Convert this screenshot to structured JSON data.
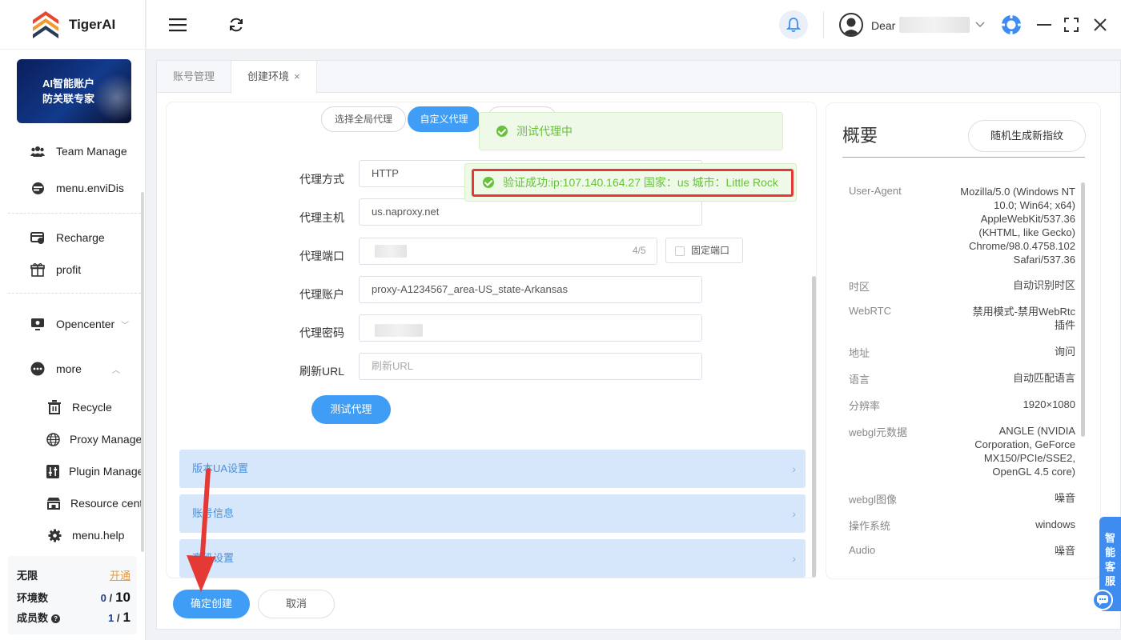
{
  "app": {
    "name": "TigerAI"
  },
  "sidebar": {
    "banner_line1": "AI智能账户",
    "banner_line2": "防关联专家",
    "items": [
      {
        "label": "Team Manage",
        "icon": "team-icon"
      },
      {
        "label": "menu.enviDis",
        "icon": "environment-icon"
      },
      {
        "label": "Recharge",
        "icon": "recharge-icon"
      },
      {
        "label": "profit",
        "icon": "gift-icon"
      },
      {
        "label": "Opencenter",
        "icon": "monitor-icon"
      },
      {
        "label": "more",
        "icon": "more-dots-icon"
      }
    ],
    "sub_items": [
      {
        "label": "Recycle",
        "icon": "trash-icon"
      },
      {
        "label": "Proxy Manager",
        "icon": "globe-icon"
      },
      {
        "label": "Plugin Manager",
        "icon": "plugin-icon"
      },
      {
        "label": "Resource center",
        "icon": "store-icon"
      },
      {
        "label": "menu.help",
        "icon": "gear-icon"
      }
    ],
    "stats": {
      "plan": "无限",
      "open": "开通",
      "env_label": "环境数",
      "env_used": "0",
      "env_sep": "/",
      "env_total": "10",
      "member_label": "成员数",
      "member_used": "1",
      "member_sep": "/",
      "member_total": "1"
    }
  },
  "header": {
    "greeting": "Dear"
  },
  "tabs": [
    {
      "label": "账号管理",
      "active": false
    },
    {
      "label": "创建环境",
      "active": true,
      "close": "×"
    }
  ],
  "proxy": {
    "modes": [
      "选择全局代理",
      "自定义代理"
    ],
    "fields": {
      "type_label": "代理方式",
      "type_value": "HTTP",
      "host_label": "代理主机",
      "host_value": "us.naproxy.net",
      "port_label": "代理端口",
      "port_count": "4/5",
      "fixed_port": "固定端口",
      "account_label": "代理账户",
      "account_value": "proxy-A1234567_area-US_state-Arkansas",
      "password_label": "代理密码",
      "refresh_label": "刷新URL",
      "refresh_placeholder": "刷新URL"
    },
    "test_button": "测试代理"
  },
  "notifications": {
    "testing": "测试代理中",
    "success": "验证成功:ip:107.140.164.27 国家：us 城市：Little Rock"
  },
  "sections": [
    "版本UA设置",
    "账号信息",
    "高级设置"
  ],
  "footer": {
    "create": "确定创建",
    "cancel": "取消"
  },
  "overview": {
    "title": "概要",
    "generate": "随机生成新指纹",
    "rows": [
      {
        "key": "User-Agent",
        "value": "Mozilla/5.0 (Windows NT 10.0; Win64; x64) AppleWebKit/537.36 (KHTML, like Gecko) Chrome/98.0.4758.102 Safari/537.36"
      },
      {
        "key": "时区",
        "value": "自动识别时区"
      },
      {
        "key": "WebRTC",
        "value": "禁用模式-禁用WebRtc插件"
      },
      {
        "key": "地址",
        "value": "询问"
      },
      {
        "key": "语言",
        "value": "自动匹配语言"
      },
      {
        "key": "分辨率",
        "value": "1920×1080"
      },
      {
        "key": "webgl元数据",
        "value": "ANGLE (NVIDIA Corporation, GeForce MX150/PCIe/SSE2, OpenGL 4.5 core)"
      },
      {
        "key": "webgl图像",
        "value": "噪音"
      },
      {
        "key": "操作系统",
        "value": "windows"
      },
      {
        "key": "Audio",
        "value": "噪音"
      }
    ]
  },
  "customer_service": "智能客服",
  "colors": {
    "primary": "#3f9df5",
    "success": "#67c23a",
    "highlight": "#e53935",
    "section_bg": "#d6e7fb"
  }
}
